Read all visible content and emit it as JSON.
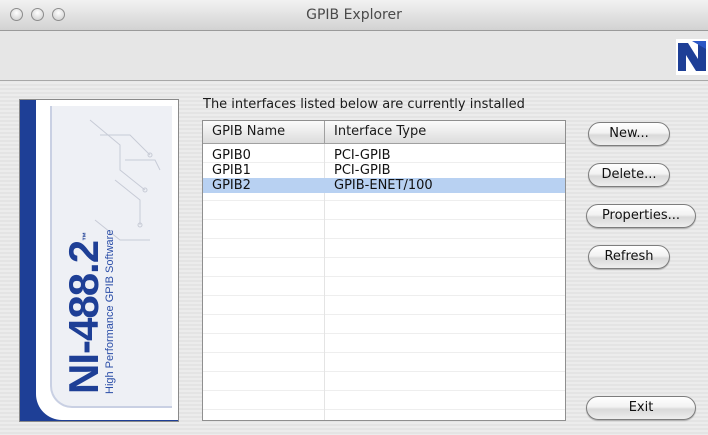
{
  "window": {
    "title": "GPIB Explorer"
  },
  "banner": {
    "product": "NI-488.2",
    "trademark": "™",
    "subtitle": "High Performance GPIB Software"
  },
  "caption": "The interfaces listed below are currently installed",
  "table": {
    "headers": [
      "GPIB Name",
      "Interface Type"
    ],
    "rows": [
      {
        "name": "GPIB0",
        "type": "PCI-GPIB"
      },
      {
        "name": "GPIB1",
        "type": "PCI-GPIB"
      },
      {
        "name": "GPIB2",
        "type": "GPIB-ENET/100",
        "selected": true
      }
    ]
  },
  "buttons": {
    "new": "New...",
    "delete": "Delete...",
    "properties": "Properties...",
    "refresh": "Refresh",
    "exit": "Exit"
  },
  "colors": {
    "selection": "#b8d1f2",
    "brand_blue": "#1e3f96"
  }
}
